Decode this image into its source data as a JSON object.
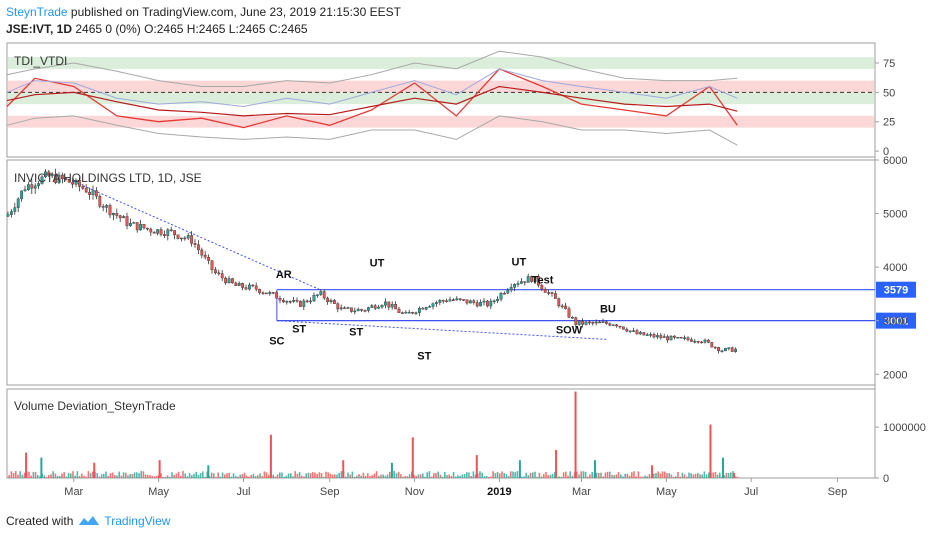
{
  "header": {
    "author": "SteynTrade",
    "published": " published on TradingView.com, June 23, 2019 21:15:30 EEST",
    "symbol": "JSE:IVT, 1D",
    "ohlc": "2465 0 (0%) O:2465 H:2465 L:2465 C:2465"
  },
  "footer": {
    "created_with": "Created with",
    "brand": "TradingView"
  },
  "colors": {
    "up": "#26a69a",
    "down": "#ef5350",
    "line": "#3f51f5",
    "priceBadge": "#2962ff",
    "rsi": "#e53935",
    "signal": "#b71c1c"
  },
  "chart_data": [
    {
      "type": "line",
      "title": "TDI_VTDI",
      "ylim": [
        -5,
        92
      ],
      "yticks": [
        0,
        25,
        50,
        75
      ],
      "bands": [
        [
          0,
          0,
          0
        ],
        [
          20,
          30,
          0
        ],
        [
          40,
          50,
          0
        ],
        [
          50,
          60,
          0
        ],
        [
          70,
          80,
          0
        ]
      ],
      "midline": 50,
      "x": [
        "2018-01-12",
        "2018-02-01",
        "2018-03-01",
        "2018-04-01",
        "2018-05-01",
        "2018-06-01",
        "2018-07-01",
        "2018-08-01",
        "2018-09-01",
        "2018-10-01",
        "2018-11-01",
        "2018-12-01",
        "2019-01-01",
        "2019-02-01",
        "2019-03-01",
        "2019-04-01",
        "2019-05-01",
        "2019-06-01",
        "2019-06-21"
      ],
      "series": [
        {
          "values": [
            38,
            62,
            55,
            30,
            25,
            28,
            20,
            30,
            22,
            35,
            58,
            30,
            70,
            55,
            40,
            35,
            30,
            55,
            22
          ]
        },
        {
          "values": [
            43,
            48,
            50,
            42,
            35,
            33,
            30,
            32,
            31,
            38,
            45,
            40,
            55,
            50,
            45,
            40,
            38,
            40,
            34
          ]
        },
        {
          "values": [
            65,
            70,
            75,
            68,
            60,
            55,
            55,
            60,
            58,
            65,
            75,
            70,
            85,
            80,
            70,
            62,
            60,
            60,
            62
          ]
        },
        {
          "values": [
            22,
            28,
            30,
            22,
            15,
            12,
            10,
            12,
            10,
            18,
            18,
            10,
            30,
            25,
            18,
            18,
            15,
            18,
            5
          ]
        },
        {
          "values": [
            50,
            60,
            58,
            45,
            40,
            42,
            38,
            45,
            40,
            50,
            60,
            48,
            70,
            60,
            55,
            50,
            45,
            55,
            45
          ]
        }
      ]
    },
    {
      "type": "line",
      "title": "INVICTA HOLDINGS LTD, 1D, JSE",
      "ylim": [
        1800,
        6000
      ],
      "yticks": [
        2000,
        3000,
        4000,
        5000,
        6000
      ],
      "xticks": [
        "Mar",
        "May",
        "Jul",
        "Sep",
        "Nov",
        "2019",
        "Mar",
        "May",
        "Jul",
        "Sep"
      ],
      "xtick_dates": [
        "2018-03-01",
        "2018-05-01",
        "2018-07-01",
        "2018-09-01",
        "2018-11-01",
        "2019-01-01",
        "2019-03-01",
        "2019-05-01",
        "2019-07-01",
        "2019-09-01"
      ],
      "x": [
        "2018-01-12",
        "2018-01-25",
        "2018-02-10",
        "2018-02-25",
        "2018-03-10",
        "2018-03-25",
        "2018-04-10",
        "2018-04-25",
        "2018-05-10",
        "2018-05-25",
        "2018-06-10",
        "2018-06-25",
        "2018-07-10",
        "2018-07-25",
        "2018-08-10",
        "2018-08-25",
        "2018-09-10",
        "2018-09-25",
        "2018-10-10",
        "2018-10-25",
        "2018-11-10",
        "2018-11-25",
        "2018-12-10",
        "2018-12-25",
        "2019-01-10",
        "2019-01-25",
        "2019-02-10",
        "2019-02-25",
        "2019-03-10",
        "2019-03-25",
        "2019-04-10",
        "2019-04-25",
        "2019-05-10",
        "2019-05-25",
        "2019-06-10",
        "2019-06-21"
      ],
      "values": [
        4950,
        5500,
        5700,
        5600,
        5450,
        5100,
        4800,
        4700,
        4650,
        4500,
        3900,
        3650,
        3600,
        3450,
        3300,
        3500,
        3200,
        3200,
        3350,
        3100,
        3300,
        3400,
        3350,
        3300,
        3700,
        3800,
        3400,
        2950,
        2950,
        2950,
        2750,
        2700,
        2650,
        2650,
        2450,
        2465
      ],
      "hlines": [
        {
          "value": 3579,
          "label": "3579"
        },
        {
          "value": 3001,
          "label": "3001"
        }
      ],
      "trendlines": [
        {
          "from": [
            "2018-02-20",
            5700
          ],
          "to": [
            "2018-08-25",
            3580
          ]
        },
        {
          "from": [
            "2018-07-25",
            3000
          ],
          "to": [
            "2019-03-20",
            2650
          ]
        }
      ],
      "annotations": [
        {
          "text": "AR",
          "x": "2018-07-30",
          "y": 3720,
          "pos": "above"
        },
        {
          "text": "SC",
          "x": "2018-07-25",
          "y": 2780,
          "pos": "below"
        },
        {
          "text": "ST",
          "x": "2018-08-10",
          "y": 3000,
          "pos": "below"
        },
        {
          "text": "ST",
          "x": "2018-09-20",
          "y": 2950,
          "pos": "below"
        },
        {
          "text": "UT",
          "x": "2018-10-05",
          "y": 3940,
          "pos": "above"
        },
        {
          "text": "ST",
          "x": "2018-11-08",
          "y": 2500,
          "pos": "below"
        },
        {
          "text": "UT",
          "x": "2019-01-15",
          "y": 3960,
          "pos": "above"
        },
        {
          "text": "Test",
          "x": "2019-02-01",
          "y": 3620,
          "pos": "above"
        },
        {
          "text": "SOW",
          "x": "2019-02-20",
          "y": 2990,
          "pos": "below"
        },
        {
          "text": "BU",
          "x": "2019-03-20",
          "y": 3080,
          "pos": "above"
        }
      ]
    },
    {
      "type": "bar",
      "title": "Volume Deviation_SteynTrade",
      "ylim": [
        0,
        1750000
      ],
      "yticks": [
        0,
        1000000
      ],
      "ytick_labels": [
        "0",
        "1000000"
      ],
      "x": [
        "2018-01-25",
        "2018-02-05",
        "2018-03-15",
        "2018-05-01",
        "2018-06-05",
        "2018-07-20",
        "2018-09-10",
        "2018-10-15",
        "2018-10-30",
        "2018-12-15",
        "2019-01-15",
        "2019-02-10",
        "2019-02-24",
        "2019-03-10",
        "2019-04-20",
        "2019-06-01",
        "2019-06-10",
        "2019-06-18"
      ],
      "values": [
        500000,
        400000,
        300000,
        350000,
        250000,
        850000,
        350000,
        300000,
        800000,
        450000,
        350000,
        550000,
        1700000,
        350000,
        250000,
        1050000,
        400000,
        100000
      ]
    }
  ]
}
